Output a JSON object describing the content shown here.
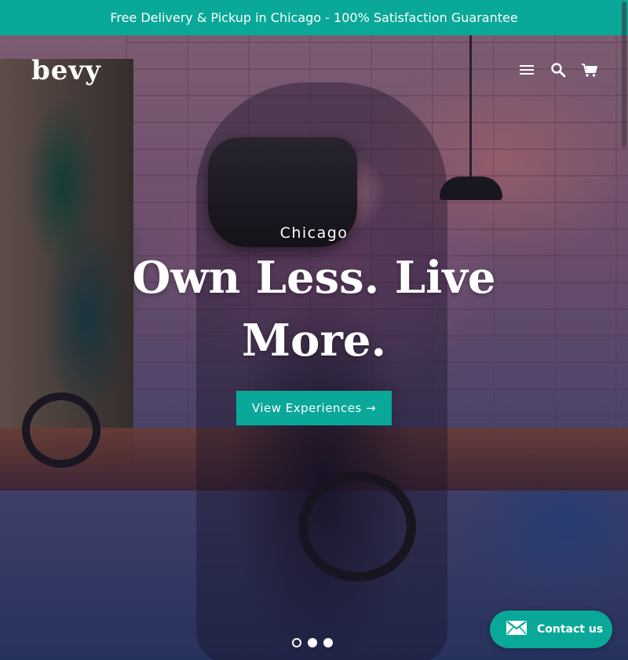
{
  "announcement": {
    "text": "Free Delivery & Pickup in Chicago - 100% Satisfaction Guarantee"
  },
  "header": {
    "logo": "bevy",
    "icons": [
      "menu-icon",
      "search-icon",
      "cart-icon"
    ]
  },
  "hero": {
    "subheading": "Chicago",
    "headline": "Own Less. Live More.",
    "cta_label": "View Experiences →",
    "slides_total": 3,
    "active_slide": 1
  },
  "contact": {
    "label": "Contact us",
    "icon": "envelope-icon"
  },
  "colors": {
    "accent": "#0aa898",
    "text_on_accent": "#ffffff"
  }
}
